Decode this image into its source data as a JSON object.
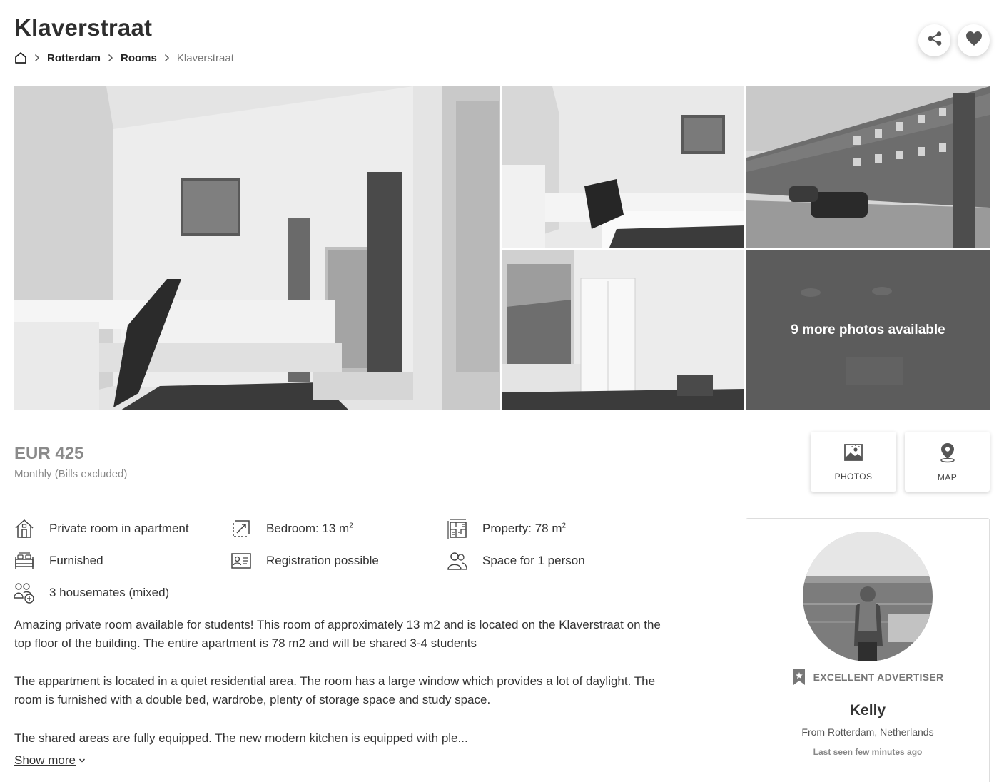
{
  "listing": {
    "title": "Klaverstraat"
  },
  "breadcrumb": {
    "home_icon": "home-icon",
    "items": [
      "Rotterdam",
      "Rooms",
      "Klaverstraat"
    ]
  },
  "actions": {
    "share_icon": "share-icon",
    "favorite_icon": "heart-icon"
  },
  "gallery": {
    "more_photos_label": "9 more photos available"
  },
  "price": {
    "amount": "EUR 425",
    "note": "Monthly (Bills excluded)"
  },
  "tiles": {
    "photos_label": "PHOTOS",
    "map_label": "MAP"
  },
  "features": {
    "room_type": "Private room in apartment",
    "bedroom_label": "Bedroom: 13 m",
    "bedroom_sup": "2",
    "property_label": "Property: 78 m",
    "property_sup": "2",
    "furnished": "Furnished",
    "registration": "Registration possible",
    "space": "Space for 1 person",
    "housemates": "3 housemates (mixed)"
  },
  "description": {
    "p1": "Amazing private room available for students! This room of approximately 13 m2 and is located on the Klaverstraat on the top floor of the building. The entire apartment is 78 m2 and will be shared 3-4 students",
    "p2": "The appartment is located in a quiet residential area. The room has a large window which provides a lot of daylight. The room is furnished with a double bed, wardrobe, plenty of storage space and study space.",
    "p3": "The shared areas are fully equipped. The new modern kitchen is equipped with ple...",
    "show_more": "Show more"
  },
  "advertiser": {
    "badge": "EXCELLENT ADVERTISER",
    "name": "Kelly",
    "from": "From Rotterdam, Netherlands",
    "last_seen": "Last seen few minutes ago"
  }
}
